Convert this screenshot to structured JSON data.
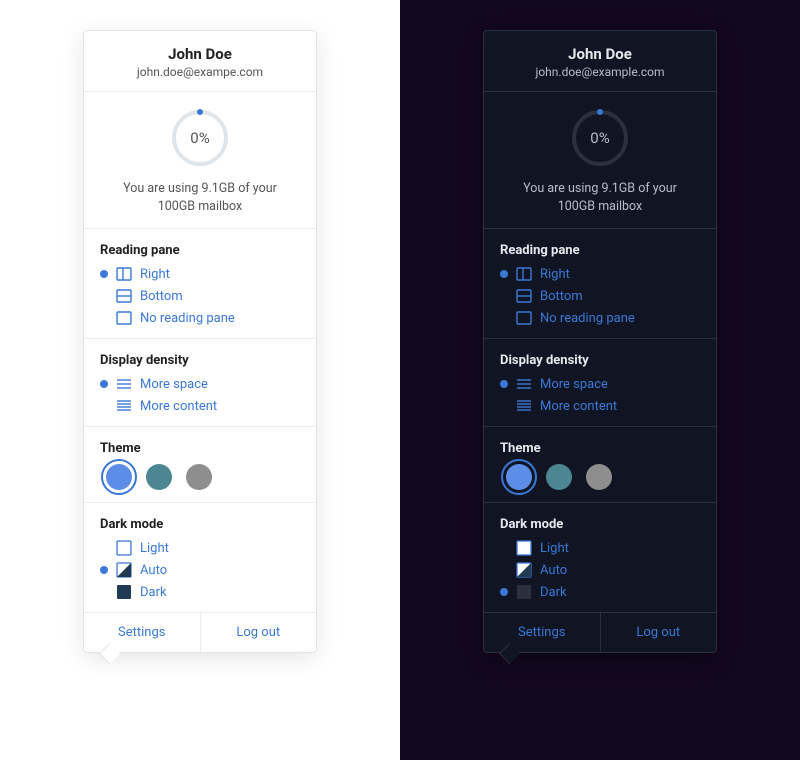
{
  "user": {
    "name": "John Doe",
    "email_light": "john.doe@exampe.com",
    "email_dark": "john.doe@example.com"
  },
  "storage": {
    "percent_label": "0%",
    "usage_line1": "You are using 9.1GB of your",
    "usage_line2": "100GB mailbox"
  },
  "reading_pane": {
    "title": "Reading pane",
    "options": [
      {
        "id": "right",
        "label": "Right",
        "selected": true
      },
      {
        "id": "bottom",
        "label": "Bottom",
        "selected": false
      },
      {
        "id": "none",
        "label": "No reading pane",
        "selected": false
      }
    ]
  },
  "display_density": {
    "title": "Display density",
    "options": [
      {
        "id": "more-space",
        "label": "More space",
        "selected": true
      },
      {
        "id": "more-content",
        "label": "More content",
        "selected": false
      }
    ]
  },
  "theme": {
    "title": "Theme",
    "swatches": [
      {
        "id": "blue",
        "color": "#5c8ee8",
        "selected": true
      },
      {
        "id": "teal",
        "color": "#4c8693",
        "selected": false
      },
      {
        "id": "grey",
        "color": "#8e8e8e",
        "selected": false
      }
    ]
  },
  "dark_mode": {
    "title": "Dark mode",
    "options": [
      {
        "id": "light",
        "label": "Light"
      },
      {
        "id": "auto",
        "label": "Auto"
      },
      {
        "id": "dark",
        "label": "Dark"
      }
    ],
    "selected_light_card": "auto",
    "selected_dark_card": "dark"
  },
  "footer": {
    "settings": "Settings",
    "logout": "Log out"
  },
  "colors": {
    "accent": "#3a78d6"
  }
}
